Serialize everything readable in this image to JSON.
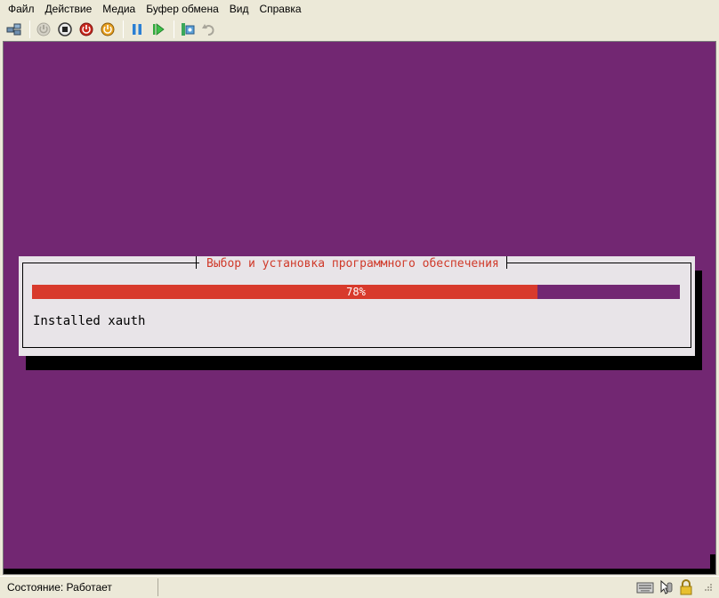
{
  "menu": {
    "items": [
      "Файл",
      "Действие",
      "Медиа",
      "Буфер обмена",
      "Вид",
      "Справка"
    ]
  },
  "toolbar": {
    "icons": [
      "ctrl-alt-del-icon",
      "start-icon",
      "turn-off-icon",
      "shutdown-icon",
      "save-state-icon",
      "pause-icon",
      "resume-icon",
      "snapshot-icon",
      "revert-icon"
    ]
  },
  "installer": {
    "title": "Выбор и установка программного обеспечения",
    "progress_percent": 78,
    "progress_label": "78%",
    "message": "Installed xauth"
  },
  "colors": {
    "console_bg": "#722772",
    "progress_fill": "#d83a2c",
    "title_text": "#d03a2a",
    "dialog_bg": "#e8e4e8"
  },
  "statusbar": {
    "status": "Состояние: Работает"
  }
}
